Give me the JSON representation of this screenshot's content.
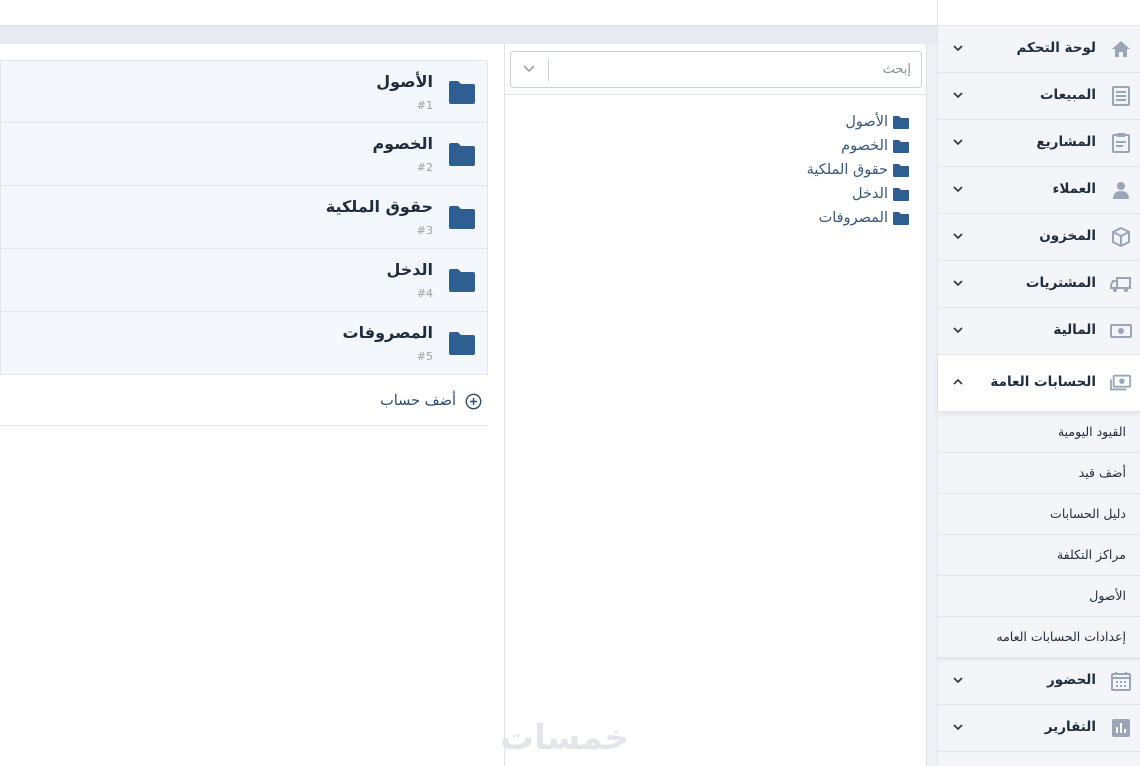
{
  "search": {
    "placeholder": "إبحث"
  },
  "tree": {
    "items": [
      {
        "label": "الأصول"
      },
      {
        "label": "الخصوم"
      },
      {
        "label": "حقوق الملكية"
      },
      {
        "label": "الدخل"
      },
      {
        "label": "المصروفات"
      }
    ]
  },
  "accounts": {
    "rows": [
      {
        "name": "الأصول",
        "number": "#1"
      },
      {
        "name": "الخصوم",
        "number": "#2"
      },
      {
        "name": "حقوق الملكية",
        "number": "#3"
      },
      {
        "name": "الدخل",
        "number": "#4"
      },
      {
        "name": "المصروفات",
        "number": "#5"
      }
    ],
    "add_label": "أضف حساب"
  },
  "sidebar": {
    "items": [
      {
        "label": "لوحة التحكم",
        "icon": "home-icon"
      },
      {
        "label": "المبيعات",
        "icon": "receipt-icon"
      },
      {
        "label": "المشاريع",
        "icon": "clipboard-icon"
      },
      {
        "label": "العملاء",
        "icon": "user-icon"
      },
      {
        "label": "المخزون",
        "icon": "box-icon"
      },
      {
        "label": "المشتريات",
        "icon": "truck-icon"
      },
      {
        "label": "المالية",
        "icon": "money-icon"
      },
      {
        "label": "الحسابات العامة",
        "icon": "money-stack-icon"
      }
    ],
    "submenu": [
      {
        "label": "القيود اليومية"
      },
      {
        "label": "أضف قيد"
      },
      {
        "label": "دليل الحسابات"
      },
      {
        "label": "مراكز التكلفة"
      },
      {
        "label": "الأصول"
      },
      {
        "label": "إعدادات الحسابات العامه"
      }
    ],
    "items_after": [
      {
        "label": "الحضور",
        "icon": "calendar-icon"
      },
      {
        "label": "التقارير",
        "icon": "bar-chart-icon"
      }
    ]
  },
  "watermark": "خمسات",
  "colors": {
    "accent": "#2f5f91",
    "sidebar_icon": "#9aa6b8"
  }
}
